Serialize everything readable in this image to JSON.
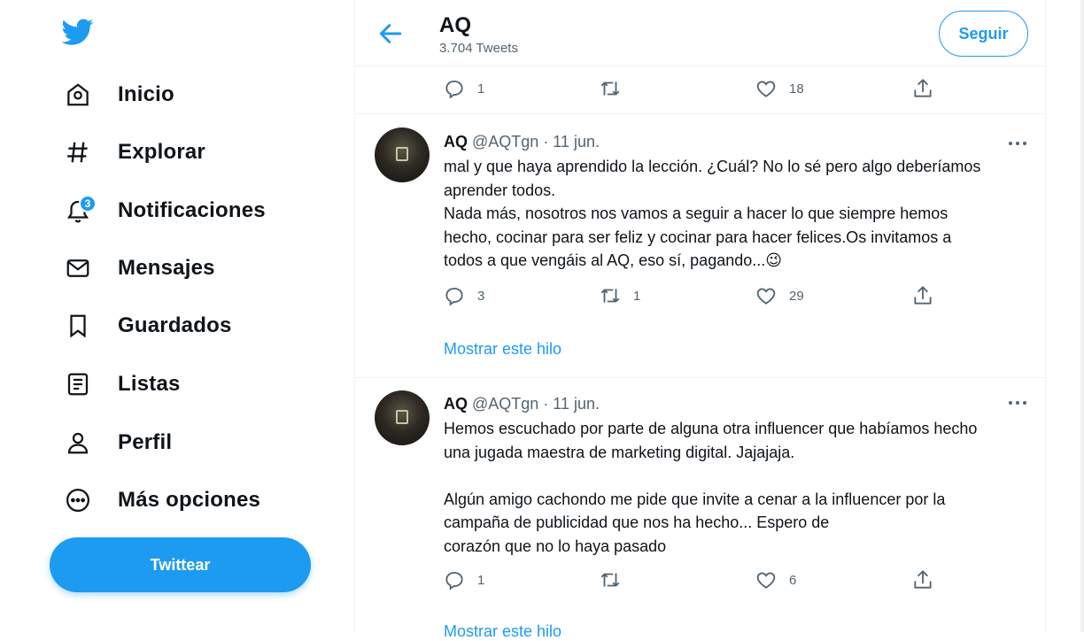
{
  "sidebar": {
    "items": [
      {
        "label": "Inicio"
      },
      {
        "label": "Explorar"
      },
      {
        "label": "Notificaciones",
        "badge": "3"
      },
      {
        "label": "Mensajes"
      },
      {
        "label": "Guardados"
      },
      {
        "label": "Listas"
      },
      {
        "label": "Perfil"
      },
      {
        "label": "Más opciones"
      }
    ],
    "tweet_button": "Twittear"
  },
  "header": {
    "title": "AQ",
    "subtitle": "3.704 Tweets",
    "follow_button": "Seguir"
  },
  "top_actions": {
    "reply": "1",
    "retweet": "",
    "like": "18"
  },
  "tweets": [
    {
      "name": "AQ",
      "meta": "@AQTgn · 11 jun.",
      "text": "mal y que haya aprendido la lección. ¿Cuál? No lo sé pero algo deberíamos\naprender todos.\nNada más, nosotros nos vamos a seguir a hacer lo que siempre hemos\nhecho, cocinar para ser feliz y cocinar para hacer felices.Os invitamos a\ntodos a que vengáis al AQ, eso sí, pagando...😉",
      "replies": "3",
      "retweets": "1",
      "likes": "29",
      "show_thread": "Mostrar este hilo"
    },
    {
      "name": "AQ",
      "meta": "@AQTgn · 11 jun.",
      "text": "Hemos escuchado por parte de alguna otra influencer que habíamos hecho\nuna jugada maestra de marketing digital. Jajajaja.\n\nAlgún amigo cachondo me pide que invite a cenar a la influencer por la\ncampaña de publicidad que nos ha hecho... Espero de\ncorazón que no lo haya pasado",
      "replies": "1",
      "retweets": "",
      "likes": "6",
      "show_thread": "Mostrar este hilo"
    }
  ],
  "colors": {
    "accent": "#1d9bf0",
    "text": "#0f1419",
    "secondary": "#536471"
  }
}
